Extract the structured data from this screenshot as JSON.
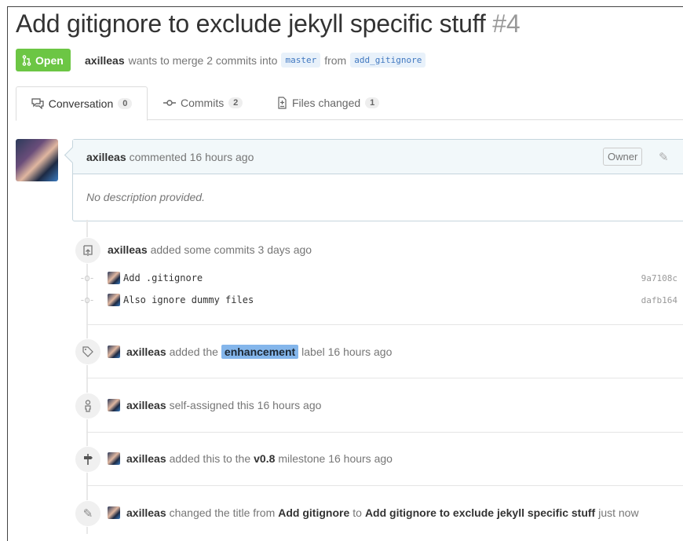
{
  "pr": {
    "title": "Add gitignore to exclude jekyll specific stuff",
    "number": "#4",
    "state": "Open",
    "author": "axilleas",
    "merge_text": "wants to merge 2 commits into",
    "base": "master",
    "from_text": "from",
    "head": "add_gitignore"
  },
  "tabs": [
    {
      "label": "Conversation",
      "count": "0"
    },
    {
      "label": "Commits",
      "count": "2"
    },
    {
      "label": "Files changed",
      "count": "1"
    }
  ],
  "comment": {
    "author": "axilleas",
    "time": "commented 16 hours ago",
    "badge": "Owner",
    "body": "No description provided."
  },
  "commits_event": {
    "author": "axilleas",
    "text": "added some commits 3 days ago"
  },
  "commits": [
    {
      "message": "Add .gitignore",
      "sha": "9a7108c"
    },
    {
      "message": "Also ignore dummy files",
      "sha": "dafb164"
    }
  ],
  "label_event": {
    "author": "axilleas",
    "text_before": "added the",
    "label": "enhancement",
    "text_after": "label 16 hours ago"
  },
  "assign_event": {
    "author": "axilleas",
    "text": "self-assigned this 16 hours ago"
  },
  "milestone_event": {
    "author": "axilleas",
    "text_before": "added this to the",
    "milestone": "v0.8",
    "text_after": "milestone 16 hours ago"
  },
  "rename_event": {
    "author": "axilleas",
    "text_before": "changed the title from",
    "old_title": "Add gitignore",
    "text_mid": "to",
    "new_title": "Add gitignore to exclude jekyll specific stuff",
    "text_after": "just now"
  },
  "colors": {
    "open": "#6cc644",
    "label": "#84b6eb",
    "link": "#4078c0"
  }
}
